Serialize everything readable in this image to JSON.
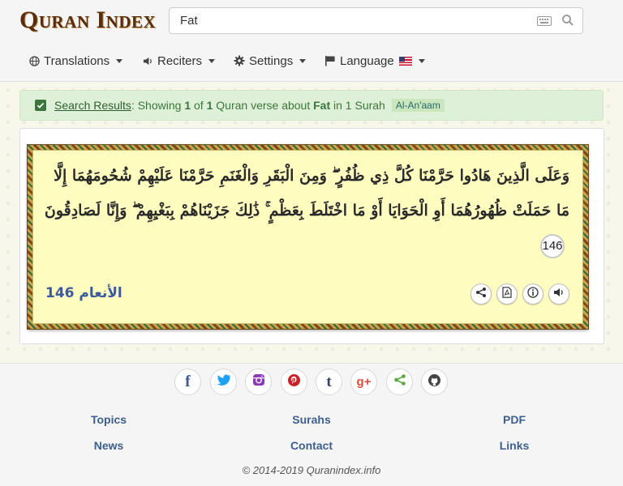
{
  "logo": "Quran Index",
  "search": {
    "value": "Fat",
    "placeholder": ""
  },
  "menu": {
    "translations": "Translations",
    "reciters": "Reciters",
    "settings": "Settings",
    "language": "Language"
  },
  "alert": {
    "link": "Search Results",
    "showing": ": Showing ",
    "count": "1",
    "of": " of ",
    "total": "1",
    "verse_about": " Quran verse about ",
    "term": "Fat",
    "in": " in 1 Surah",
    "surah_badge": "Al-An'aam"
  },
  "verse": {
    "text": "وَعَلَى الَّذِينَ هَادُوا حَرَّمْنَا كُلَّ ذِي ظُفُرٍ ۖ وَمِنَ الْبَقَرِ وَالْغَنَمِ حَرَّمْنَا عَلَيْهِمْ شُحُومَهُمَا إِلَّا مَا حَمَلَتْ ظُهُورُهُمَا أَوِ الْحَوَايَا أَوْ مَا اخْتَلَطَ بِعَظْمٍ ۚ ذَٰلِكَ جَزَيْنَاهُمْ بِبَغْيِهِمْ ۖ وَإِنَّا لَصَادِقُونَ",
    "number": "146",
    "reference": "الأنعام 146"
  },
  "footer": {
    "links": [
      "Topics",
      "Surahs",
      "PDF",
      "News",
      "Contact",
      "Links"
    ],
    "copyright": "© 2014-2019 Quranindex.info"
  },
  "colors": {
    "facebook": "#3b5998",
    "twitter": "#1da1f2",
    "instagram": "#8a3ab9",
    "pinterest": "#cb2027",
    "tumblr": "#35465c",
    "googleplus": "#dd4b39",
    "share": "#5aa844",
    "github": "#444444"
  }
}
